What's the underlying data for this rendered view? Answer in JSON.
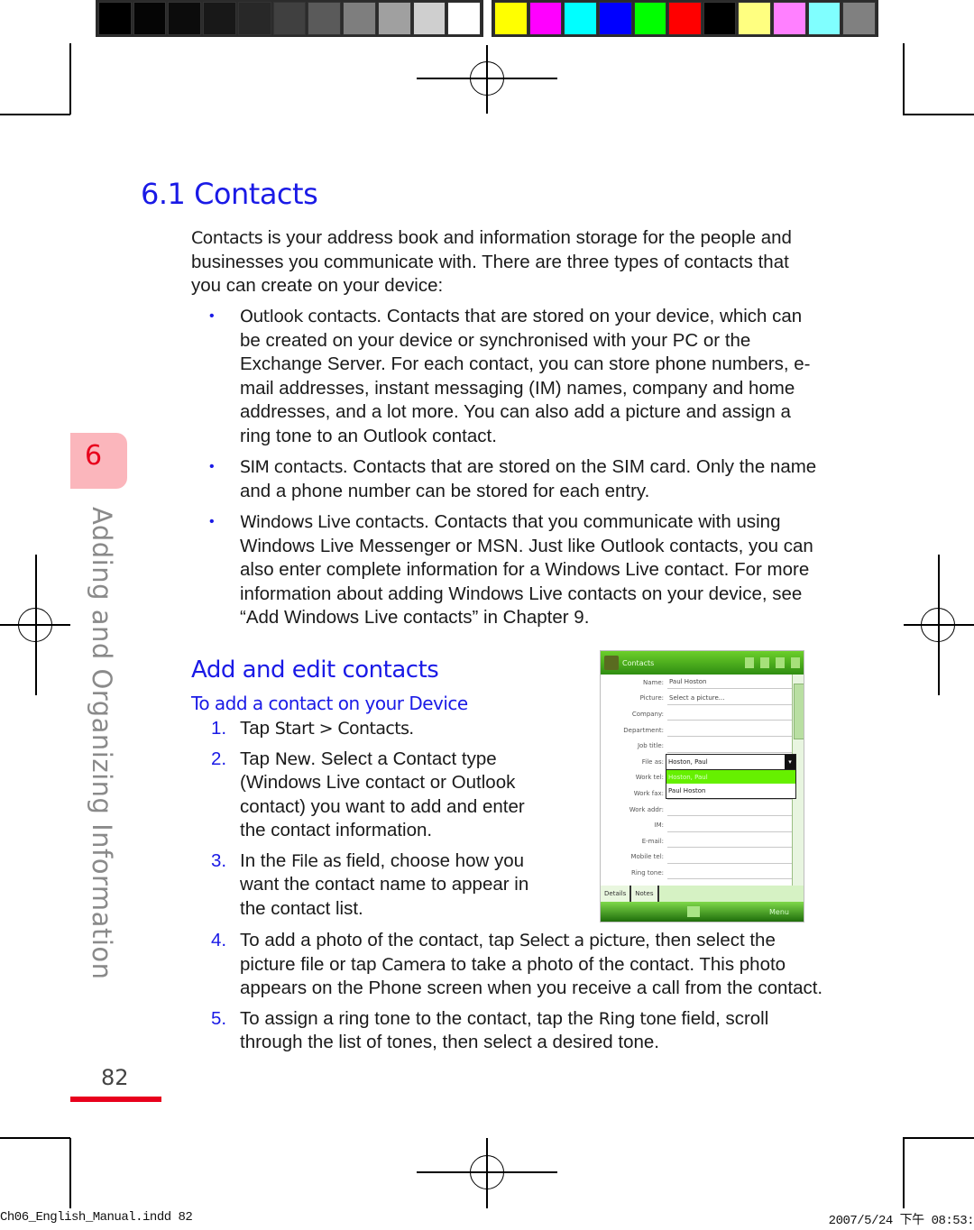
{
  "color_bars": {
    "grayscale": [
      "#000000",
      "#050505",
      "#0c0c0c",
      "#181818",
      "#282828",
      "#404040",
      "#5a5a5a",
      "#7e7e7e",
      "#a0a0a0",
      "#cfcfcf",
      "#ffffff"
    ],
    "colors": [
      "#ffff00",
      "#ff00ff",
      "#00ffff",
      "#0000ff",
      "#00ff00",
      "#ff0000",
      "#000000",
      "#ffff80",
      "#ff80ff",
      "#80ffff",
      "#808080"
    ]
  },
  "accent_colors": {
    "heading_blue": "#1a1ae6",
    "chapter_red": "#e8001c",
    "tab_pink": "#fbb6bc"
  },
  "section": {
    "heading": "6.1 Contacts",
    "intro": {
      "term": "Contacts",
      "text": " is your address book and information storage for the people and businesses you communicate with. There are three types of contacts that you can create on your device:"
    },
    "bullets": [
      {
        "term": "Outlook contacts",
        "text": ". Contacts that are stored on your device, which can be created on your device or synchronised with your PC or the Exchange Server. For each contact, you can store phone numbers, e-mail addresses, instant messaging (IM) names, company and home addresses, and a lot more. You can also add a picture and assign a ring tone to an Outlook contact."
      },
      {
        "term": "SIM contacts",
        "text": ". Contacts that are stored on the SIM card. Only the name and a phone number can be stored for each entry."
      },
      {
        "term": "Windows Live contacts",
        "text": ". Contacts that you communicate with using Windows Live Messenger or MSN. Just like Outlook contacts, you can also enter complete information for a Windows Live contact. For more information about adding Windows Live contacts on your device, see “Add Windows Live contacts” in Chapter 9."
      }
    ],
    "bullet_glyph": "•"
  },
  "subsection": {
    "heading": "Add and edit contacts",
    "procedure_title": "To add a contact on your Device",
    "steps": [
      {
        "num": "1.",
        "parts": [
          "Tap ",
          "Start > Contacts",
          "."
        ]
      },
      {
        "num": "2.",
        "parts": [
          "Tap ",
          "New",
          ". Select a Contact type (Windows Live contact or Outlook contact) you want to add and enter the contact information."
        ]
      },
      {
        "num": "3.",
        "parts": [
          "In the ",
          "File as",
          " field, choose how you want the contact name to appear in the contact list."
        ]
      },
      {
        "num": "4.",
        "parts": [
          "To add a photo of the contact, tap ",
          "Select a picture",
          ", then select the picture file or tap ",
          "Camera",
          " to take a photo of the contact. This photo appears on the Phone screen when you receive a call from the contact."
        ]
      },
      {
        "num": "5.",
        "parts": [
          "To assign a ring tone to the contact, tap the ",
          "Ring tone",
          " field, scroll through the list of tones, then select a desired tone."
        ]
      }
    ]
  },
  "phone_screenshot": {
    "title": "Contacts",
    "fields": [
      {
        "label": "Name:",
        "value": "Paul Hoston"
      },
      {
        "label": "Picture:",
        "value": "Select a picture..."
      },
      {
        "label": "Company:",
        "value": ""
      },
      {
        "label": "Department:",
        "value": ""
      },
      {
        "label": "Job title:",
        "value": ""
      },
      {
        "label": "File as:",
        "value": ""
      },
      {
        "label": "Work tel:",
        "value": ""
      },
      {
        "label": "Work fax:",
        "value": ""
      },
      {
        "label": "Work addr:",
        "value": ""
      },
      {
        "label": "IM:",
        "value": ""
      },
      {
        "label": "E-mail:",
        "value": ""
      },
      {
        "label": "Mobile tel:",
        "value": ""
      },
      {
        "label": "Ring tone:",
        "value": ""
      }
    ],
    "file_as_dropdown": {
      "selected": "Hoston, Paul",
      "options": [
        "Hoston, Paul",
        "Paul Hoston"
      ],
      "highlighted_index": 0
    },
    "tabs": [
      "Details",
      "Notes"
    ],
    "softkey_right": "Menu"
  },
  "side_tab": {
    "chapter_number": "6",
    "chapter_title": "Adding and Organizing Information"
  },
  "page_number": "82",
  "slug": {
    "left": "Ch06_English_Manual.indd   82",
    "right": "2007/5/24   下午 08:53:"
  }
}
